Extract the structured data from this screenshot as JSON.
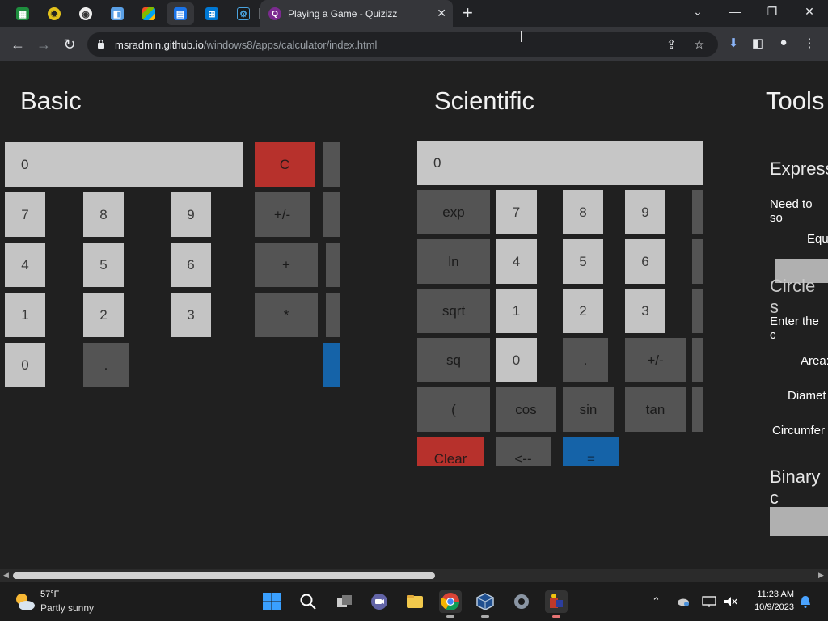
{
  "browser": {
    "active_tab_title": "Playing a Game - Quizizz",
    "url_host": "msradmin.github.io",
    "url_path": "/windows8/apps/calculator/index.html",
    "pinned_tab_icons": [
      "sheets-icon",
      "virus-icon",
      "shield-icon",
      "browser-icon",
      "windows-logo-icon",
      "calculator-icon",
      "windows-blue-icon",
      "settings-gear-icon"
    ],
    "new_tab_label": "+",
    "close_label": "✕"
  },
  "calculator": {
    "basic": {
      "title": "Basic",
      "display": "0",
      "keys": {
        "k7": "7",
        "k8": "8",
        "k9": "9",
        "k4": "4",
        "k5": "5",
        "k6": "6",
        "k1": "1",
        "k2": "2",
        "k3": "3",
        "k0": "0",
        "dot": ".",
        "clear": "C",
        "negate": "+/-",
        "plus": "+",
        "multiply": "*"
      }
    },
    "scientific": {
      "title": "Scientific",
      "display": "0",
      "keys": {
        "exp": "exp",
        "ln": "ln",
        "sqrt": "sqrt",
        "sq": "sq",
        "paren": "(",
        "k7": "7",
        "k8": "8",
        "k9": "9",
        "k4": "4",
        "k5": "5",
        "k6": "6",
        "k1": "1",
        "k2": "2",
        "k3": "3",
        "k0": "0",
        "dot": ".",
        "negate": "+/-",
        "cos": "cos",
        "sin": "sin",
        "tan": "tan",
        "clear": "Clear",
        "backspace": "<--",
        "equals": "="
      }
    },
    "tools": {
      "title": "Tools",
      "express_heading": "Express",
      "need_to_text": "Need to so",
      "equ_label": "Equ",
      "circle_heading": "Circle s",
      "enter_text": "Enter the c",
      "area_label": "Area:",
      "diameter_label": "Diamet",
      "circumference_label": "Circumfer",
      "binary_heading": "Binary c"
    }
  },
  "taskbar": {
    "weather_temp": "57°F",
    "weather_desc": "Partly sunny",
    "time": "11:23 AM",
    "date": "10/9/2023"
  },
  "colors": {
    "red_key": "#b7312c",
    "blue_key": "#1563a8",
    "light_key": "#c4c4c4",
    "dark_key": "#545454"
  }
}
